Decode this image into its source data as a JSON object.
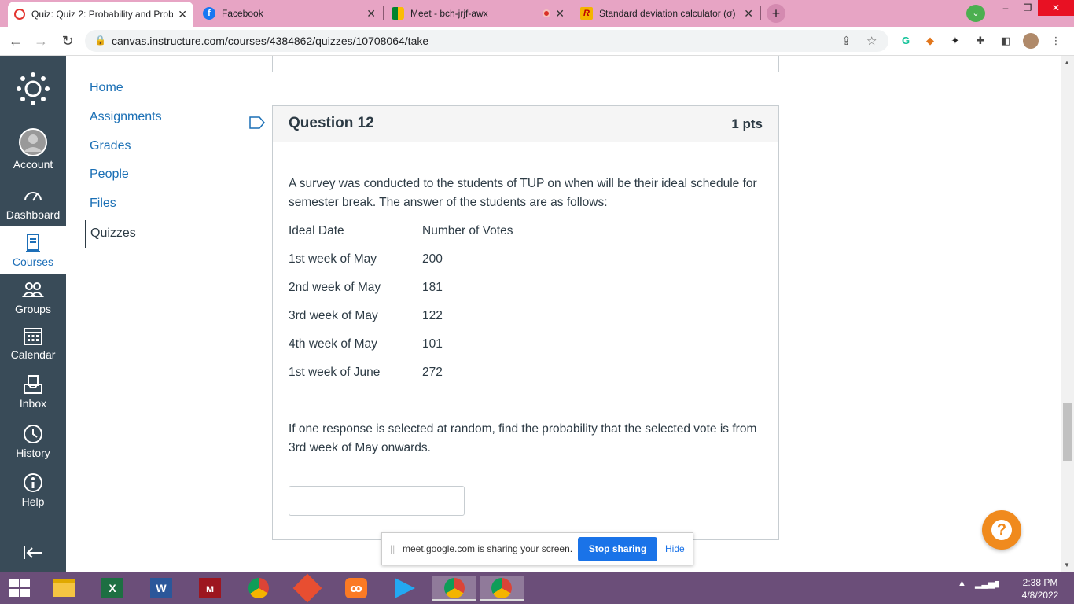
{
  "browser": {
    "tabs": [
      {
        "title": "Quiz: Quiz 2: Probability and Prob",
        "favicon": "canvas-icon",
        "active": true
      },
      {
        "title": "Facebook",
        "favicon": "facebook-icon",
        "active": false
      },
      {
        "title": "Meet - bch-jrjf-awx",
        "favicon": "google-meet-icon",
        "active": false,
        "recording": true
      },
      {
        "title": "Standard deviation calculator (σ)",
        "favicon": "rapidtables-icon",
        "active": false
      }
    ],
    "url": "canvas.instructure.com/courses/4384862/quizzes/10708064/take",
    "accent_color": "#e7a4c4"
  },
  "global_nav": {
    "items": [
      {
        "label": "Account",
        "icon": "avatar-icon"
      },
      {
        "label": "Dashboard",
        "icon": "dashboard-icon"
      },
      {
        "label": "Courses",
        "icon": "courses-icon",
        "active": true
      },
      {
        "label": "Groups",
        "icon": "groups-icon"
      },
      {
        "label": "Calendar",
        "icon": "calendar-icon"
      },
      {
        "label": "Inbox",
        "icon": "inbox-icon"
      },
      {
        "label": "History",
        "icon": "history-icon"
      },
      {
        "label": "Help",
        "icon": "help-icon"
      }
    ],
    "bg_color": "#394b58"
  },
  "course_nav": {
    "items": [
      "Home",
      "Assignments",
      "Grades",
      "People",
      "Files",
      "Quizzes"
    ],
    "current": "Quizzes"
  },
  "question": {
    "title": "Question 12",
    "points": "1 pts",
    "intro": "A survey was conducted to the students of TUP on when will be their ideal schedule for semester break. The answer of the students are as follows:",
    "table": {
      "headers": [
        "Ideal Date",
        "Number of Votes"
      ],
      "rows": [
        [
          "1st week of May",
          "200"
        ],
        [
          "2nd week of May",
          "181"
        ],
        [
          "3rd week of May",
          "122"
        ],
        [
          "4th week of May",
          "101"
        ],
        [
          "1st week of June",
          "272"
        ]
      ]
    },
    "prompt": "If one response is selected at random, find the probability that the selected vote is from 3rd week of May onwards.",
    "answer_value": ""
  },
  "share_bar": {
    "message": "meet.google.com is sharing your screen.",
    "stop_label": "Stop sharing",
    "hide_label": "Hide"
  },
  "taskbar": {
    "time": "2:38 PM",
    "date": "4/8/2022",
    "apps": [
      "start-icon",
      "file-explorer-icon",
      "excel-icon",
      "word-icon",
      "mendeley-icon",
      "chrome-icon",
      "git-icon",
      "xampp-icon",
      "vscode-icon",
      "chrome-icon",
      "chrome-icon"
    ]
  }
}
